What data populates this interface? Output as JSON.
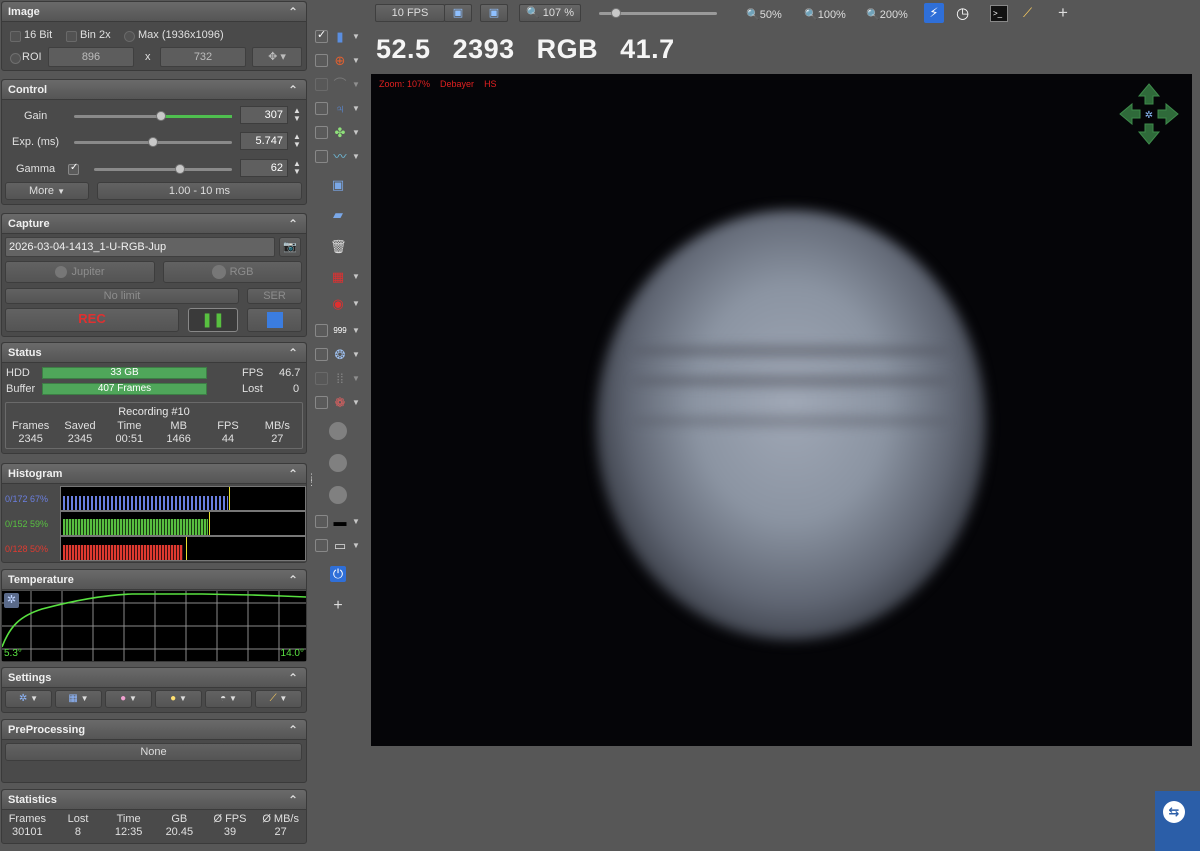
{
  "image_panel": {
    "title": "Image",
    "opt_16bit": "16 Bit",
    "opt_bin2x": "Bin 2x",
    "opt_max": "Max (1936x1096)",
    "opt_roi": "ROI",
    "roi_w": "896",
    "roi_sep": "x",
    "roi_h": "732"
  },
  "control_panel": {
    "title": "Control",
    "gain_label": "Gain",
    "gain_value": "307",
    "gain_level": 0.55,
    "exp_label": "Exp. (ms)",
    "exp_value": "5.747",
    "exp_level": 0.5,
    "gamma_label": "Gamma",
    "gamma_value": "62",
    "gamma_level": 0.62,
    "more_label": "More",
    "range_label": "1.00 - 10 ms"
  },
  "capture_panel": {
    "title": "Capture",
    "filename": "2026-03-04-1413_1-U-RGB-Jup",
    "object_label": "Jupiter",
    "filter_label": "RGB",
    "limit_label": "No limit",
    "format_label": "SER",
    "rec_label": "REC"
  },
  "status_panel": {
    "title": "Status",
    "hdd_label": "HDD",
    "hdd_value": "33 GB",
    "buffer_label": "Buffer",
    "buffer_value": "407 Frames",
    "fps_label": "FPS",
    "fps_value": "46.7",
    "lost_label": "Lost",
    "lost_value": "0",
    "recording_title": "Recording #10",
    "columns": [
      {
        "label": "Frames",
        "value": "2345"
      },
      {
        "label": "Saved",
        "value": "2345"
      },
      {
        "label": "Time",
        "value": "00:51"
      },
      {
        "label": "MB",
        "value": "1466"
      },
      {
        "label": "FPS",
        "value": "44"
      },
      {
        "label": "MB/s",
        "value": "27"
      }
    ]
  },
  "histogram_panel": {
    "title": "Histogram",
    "blue_label": "0/172 67%",
    "green_label": "0/152 59%",
    "red_label": "0/128 50%",
    "blue_color": "#6a7fe0",
    "green_color": "#58c040",
    "red_color": "#e03a30"
  },
  "temperature_panel": {
    "title": "Temperature",
    "min_label": "5.3°",
    "max_label": "14.0°"
  },
  "settings_panel": {
    "title": "Settings"
  },
  "preprocessing_panel": {
    "title": "PreProcessing",
    "value": "None"
  },
  "statistics_panel": {
    "title": "Statistics",
    "columns": [
      {
        "label": "Frames",
        "value": "30101"
      },
      {
        "label": "Lost",
        "value": "8"
      },
      {
        "label": "Time",
        "value": "12:35"
      },
      {
        "label": "GB",
        "value": "20.45"
      },
      {
        "label": "Ø FPS",
        "value": "39"
      },
      {
        "label": "Ø MB/s",
        "value": "27"
      }
    ]
  },
  "topbar": {
    "fps_limit": "10 FPS",
    "zoom_value": "107 %",
    "zoom_50": "50%",
    "zoom_100": "100%",
    "zoom_200": "200%",
    "plus": "+"
  },
  "bigstats": {
    "v1": "52.5",
    "v2": "2393",
    "v3": "RGB",
    "v4": "41.7"
  },
  "overlay": {
    "zoom": "Zoom: 107%",
    "debayer": "Debayer",
    "hs": "HS"
  },
  "toolcol": {
    "plus": "+"
  },
  "colors": {
    "accent_green": "#4fa65a",
    "rec_red": "#e03030",
    "viewport_bg": "#050508"
  }
}
